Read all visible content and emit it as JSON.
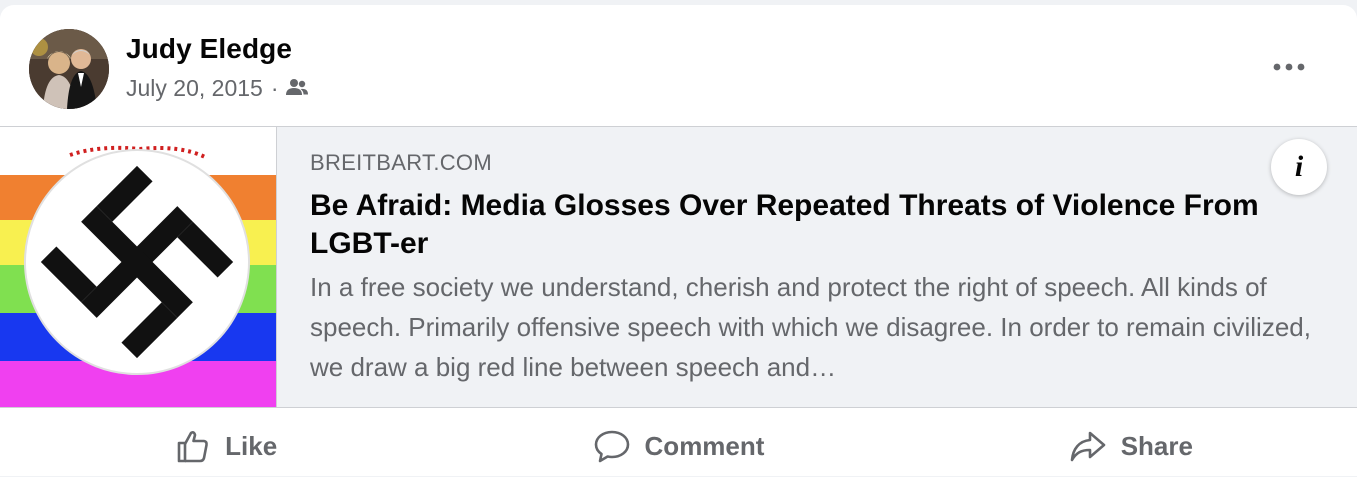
{
  "post": {
    "author": "Judy Eledge",
    "date": "July 20, 2015",
    "separator": "·",
    "audience_icon": "friends-icon",
    "more_icon": "more-options-icon"
  },
  "link_preview": {
    "domain": "BREITBART.COM",
    "headline": "Be Afraid: Media Glosses Over Repeated Threats of Violence From LGBT-er",
    "description": "In a free society we understand, cherish and protect the right of speech. All kinds of speech. Primarily offensive speech with which we disagree. In order to remain civilized, we draw a big red line between speech and…",
    "info_label": "i",
    "thumbnail_stripes": [
      "#f08030",
      "#f8f050",
      "#80e050",
      "#1838f0",
      "#f040f0"
    ]
  },
  "actions": [
    {
      "label": "Like",
      "icon": "thumbs-up-icon"
    },
    {
      "label": "Comment",
      "icon": "comment-icon"
    },
    {
      "label": "Share",
      "icon": "share-icon"
    }
  ],
  "colors": {
    "secondary_text": "#65676b",
    "primary_text": "#050505",
    "preview_bg": "#f0f2f5"
  }
}
